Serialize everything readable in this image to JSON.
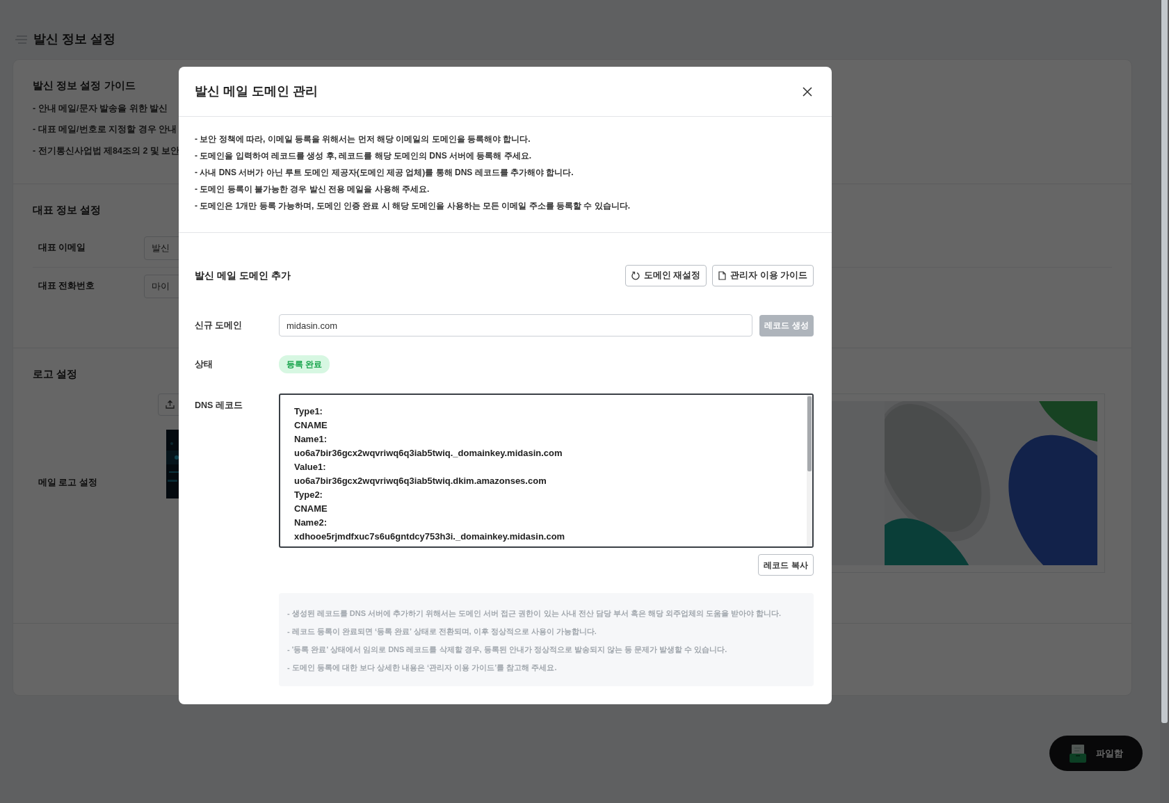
{
  "page": {
    "title": "발신 정보 설정"
  },
  "guide": {
    "title": "발신 정보 설정 가이드",
    "items": [
      "- 안내 메일/문자 발송을 위한 발신",
      "- 대표 메일/번호로 지정할 경우 안내",
      "- 전기통신사업법 제84조의 2 및 보안"
    ]
  },
  "representative": {
    "title": "대표 정보 설정",
    "rows": [
      {
        "label": "대표 이메일",
        "value": "발신"
      },
      {
        "label": "대표 전화번호",
        "value": "마이"
      }
    ]
  },
  "logo": {
    "title": "로고 설정",
    "label": "메일 로고 설정"
  },
  "file_box_button": {
    "label": "파일함"
  },
  "modal": {
    "title": "발신 메일 도메인 관리",
    "guide": [
      "- 보안 정책에 따라, 이메일 등록을 위해서는 먼저 해당 이메일의 도메인을 등록해야 합니다.",
      "- 도메인을 입력하여 레코드를 생성 후, 레코드를 해당 도메인의 DNS 서버에 등록해 주세요.",
      "- 사내 DNS 서버가 아닌 루트 도메인 제공자(도메인 제공 업체)를 통해 DNS 레코드를 추가해야 합니다.",
      "- 도메인 등록이 불가능한 경우 발신 전용 메일을 사용해 주세요.",
      "- 도메인은 1개만 등록 가능하며, 도메인 인증 완료 시 해당 도메인을 사용하는 모든 이메일 주소를 등록할 수 있습니다."
    ],
    "section_title": "발신 메일 도메인 추가",
    "actions": [
      {
        "label": "도메인 재설정"
      },
      {
        "label": "관리자 이용 가이드"
      }
    ],
    "domain": {
      "label": "신규 도메인",
      "value": "midasin.com"
    },
    "generate_button": {
      "label": "레코드 생성",
      "disabled": true
    },
    "status": {
      "label": "상태",
      "badge": "등록 완료"
    },
    "dns": {
      "label": "DNS 레코드",
      "lines": [
        "Type1:",
        "CNAME",
        "Name1:",
        "uo6a7bir36gcx2wqvriwq6q3iab5twiq._domainkey.midasin.com",
        "Value1:",
        "uo6a7bir36gcx2wqvriwq6q3iab5twiq.dkim.amazonses.com",
        "Type2:",
        "CNAME",
        "Name2:",
        "xdhooe5rjmdfxuc7s6u6gntdcy753h3i._domainkey.midasin.com"
      ]
    },
    "copy_button": {
      "label": "레코드 복사"
    },
    "notes": [
      "- 생성된 레코드를 DNS 서버에 추가하기 위해서는 도메인 서버 접근 권한이 있는 사내 전산 담당 부서 혹은 해당 외주업체의 도움을 받아야 합니다.",
      "- 레코드 등록이 완료되면 ‘등록 완료’ 상태로 전환되며, 이후 정상적으로 사용이 가능합니다.",
      "- '등록 완료' 상태에서 임의로 DNS 레코드를 삭제할 경우, 등록된 안내가 정상적으로 발송되지 않는 등 문제가 발생할 수 있습니다.",
      "- 도메인 등록에 대한 보다 상세한 내용은 ‘관리자 이용 가이드’를 참고해 주세요."
    ]
  }
}
